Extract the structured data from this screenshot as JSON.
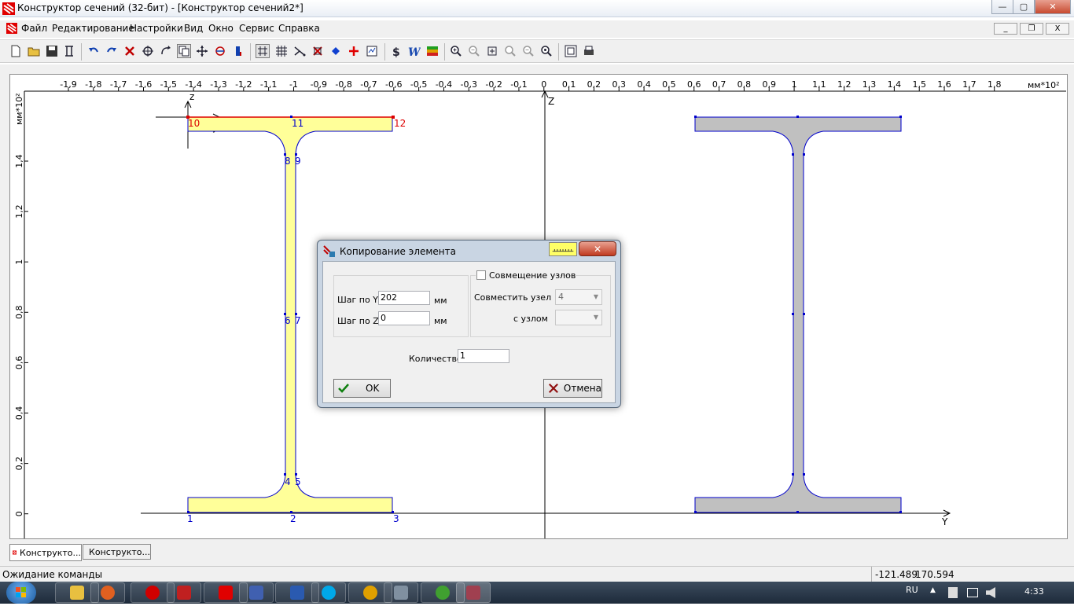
{
  "window": {
    "title": "Конструктор сечений (32-бит) - [Конструктор сечений2*]",
    "minimize": "—",
    "maximize": "▢",
    "close": "✕"
  },
  "menu": {
    "items": [
      "Файл",
      "Редактирование",
      "Настройки",
      "Вид",
      "Окно",
      "Сервис",
      "Справка"
    ],
    "mdi_min": "_",
    "mdi_restore": "❐",
    "mdi_close": "X"
  },
  "toolbar": {
    "icons": [
      "new-file-icon",
      "open-folder-icon",
      "save-icon",
      "properties-icon",
      "undo-icon",
      "redo-icon",
      "delete-icon",
      "snap-icon",
      "rotate-icon",
      "copy-element-icon",
      "move-icon",
      "mirror-icon",
      "section-icon",
      "cursor-grid-icon",
      "grid-icon",
      "nodes-icon",
      "delete-nodes-icon",
      "diamond-icon",
      "add-node-icon",
      "calculate-icon",
      "dollar-icon",
      "word-report-icon",
      "color-fill-icon",
      "zoom-in-icon",
      "zoom-out-icon",
      "zoom-fit-icon",
      "zoom-window-icon",
      "zoom-prev-icon",
      "zoom-all-icon",
      "print-icon",
      "print-setup-icon"
    ]
  },
  "ruler": {
    "top_ticks": [
      "-1,9",
      "-1,8",
      "-1,7",
      "-1,6",
      "-1,5",
      "-1,4",
      "-1,3",
      "-1,2",
      "-1,1",
      "-1",
      "-0,9",
      "-0,8",
      "-0,7",
      "-0,6",
      "-0,5",
      "-0,4",
      "-0,3",
      "-0,2",
      "-0,1",
      "0",
      "0,1",
      "0,2",
      "0,3",
      "0,4",
      "0,5",
      "0,6",
      "0,7",
      "0,8",
      "0,9",
      "1",
      "1,1",
      "1,2",
      "1,3",
      "1,4",
      "1,5",
      "1,6",
      "1,7",
      "1,8"
    ],
    "top_unit": "мм*10²",
    "left_ticks": [
      "1,4",
      "1,2",
      "1",
      "0,8",
      "0,6",
      "0,4",
      "0,2",
      "0"
    ],
    "left_unit": "мм*10²"
  },
  "canvas": {
    "axis_y": "Y",
    "axis_z": "Z",
    "local_y": "y",
    "local_z": "z",
    "node_labels": [
      "1",
      "2",
      "3",
      "4",
      "5",
      "6",
      "7",
      "8",
      "9",
      "10",
      "11",
      "12"
    ],
    "colors": {
      "section_fill": "#ffff99",
      "copy_fill": "#c0c0c0",
      "outline": "#0000cc",
      "highlight_edge": "#dd0000",
      "node_label": "#0000cc",
      "selected_label": "#dd0000"
    }
  },
  "dialog": {
    "title": "Копирование элемента",
    "close": "✕",
    "step_y_label": "Шаг по Y",
    "step_y_value": "202",
    "step_y_unit": "мм",
    "step_z_label": "Шаг по Z",
    "step_z_value": "0",
    "step_z_unit": "мм",
    "merge_nodes_label": "Совмещение узлов",
    "merge_nodes_checked": false,
    "merge_node_label": "Совместить узел",
    "merge_node_value": "4",
    "with_node_label": "с узлом",
    "with_node_value": "",
    "count_label": "Количество",
    "count_value": "1",
    "ok_label": "OK",
    "cancel_label": "Отмена"
  },
  "tabs": [
    "Конструкто...",
    "Конструкто..."
  ],
  "status": {
    "message": "Ожидание команды",
    "coord_y": "-121.489",
    "coord_z": "170.594"
  },
  "taskbar": {
    "language": "RU",
    "time": "4:33"
  }
}
